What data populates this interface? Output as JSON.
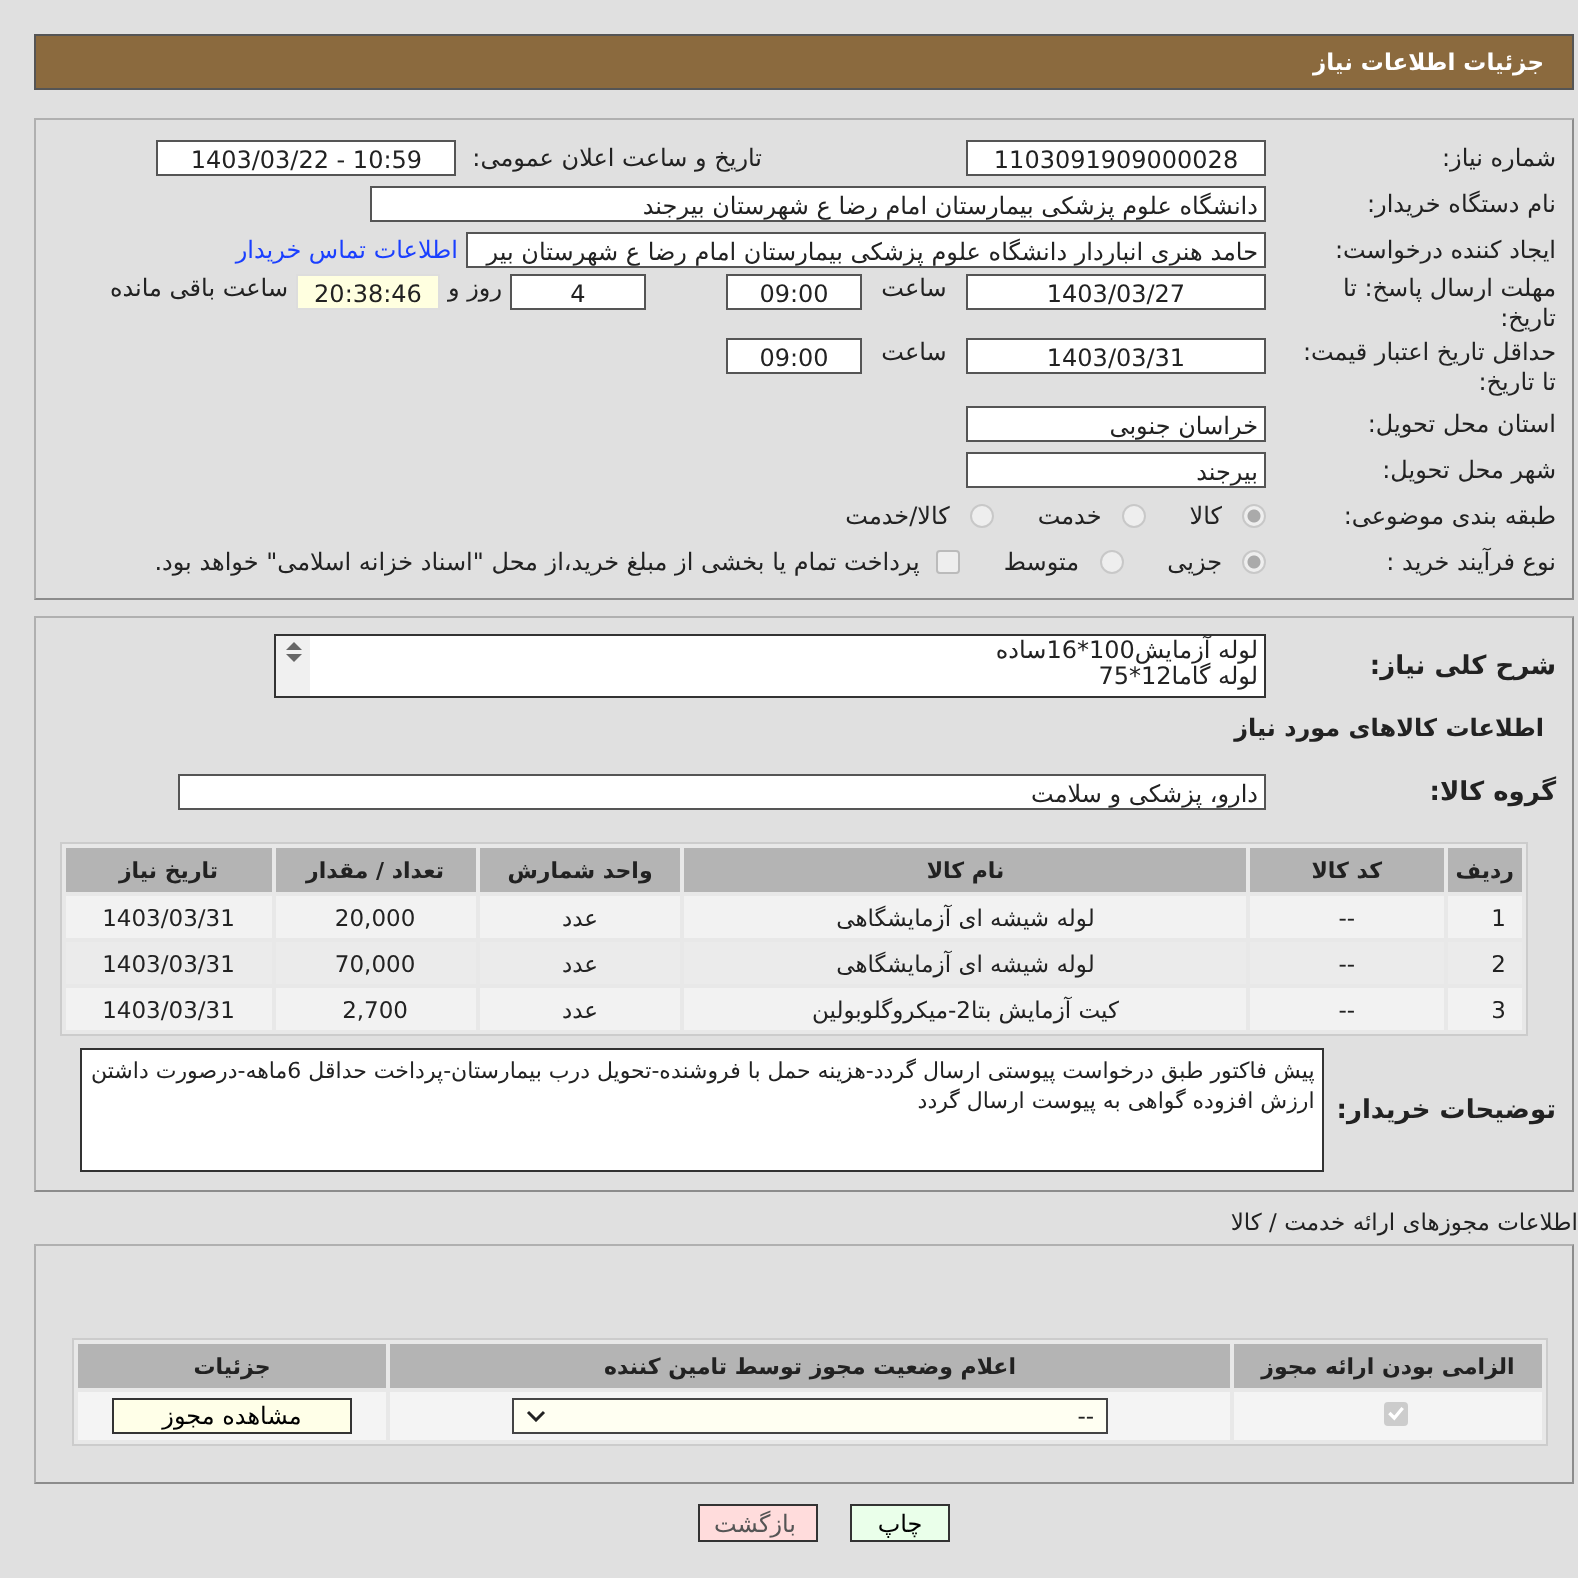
{
  "header": {
    "title": "جزئیات اطلاعات نیاز"
  },
  "need_info": {
    "need_number": {
      "label": "شماره نیاز:",
      "value": "1103091909000028"
    },
    "announce": {
      "label": "تاریخ و ساعت اعلان عمومی:",
      "value": "1403/03/22 - 10:59"
    },
    "buyer_org": {
      "label": "نام دستگاه خریدار:",
      "value": "دانشگاه علوم پزشکی  بیمارستان امام رضا ع  شهرستان بیرجند"
    },
    "creator": {
      "label": "ایجاد کننده درخواست:",
      "value": "حامد هنری انباردار دانشگاه علوم پزشکی  بیمارستان امام رضا ع  شهرستان بیر",
      "link": "اطلاعات تماس خریدار"
    },
    "deadline": {
      "label": "مهلت ارسال پاسخ: تا تاریخ:",
      "date": "1403/03/27",
      "time_label": "ساعت",
      "time": "09:00",
      "days": "4",
      "days_label": "روز و",
      "remaining": "20:38:46",
      "remaining_label": "ساعت باقی مانده"
    },
    "validity": {
      "label": "حداقل تاریخ اعتبار قیمت: تا تاریخ:",
      "date": "1403/03/31",
      "time_label": "ساعت",
      "time": "09:00"
    },
    "province": {
      "label": "استان محل تحویل:",
      "value": "خراسان جنوبی"
    },
    "city": {
      "label": "شهر محل تحویل:",
      "value": "بیرجند"
    },
    "category": {
      "label": "طبقه بندی موضوعی:",
      "options": [
        {
          "label": "کالا",
          "selected": true
        },
        {
          "label": "خدمت",
          "selected": false
        },
        {
          "label": "کالا/خدمت",
          "selected": false
        }
      ]
    },
    "process": {
      "label": "نوع فرآیند خرید :",
      "options": [
        {
          "label": "جزیی",
          "selected": true
        },
        {
          "label": "متوسط",
          "selected": false
        }
      ],
      "treasury": {
        "label": "پرداخت تمام یا بخشی از مبلغ خرید،از محل \"اسناد خزانه اسلامی\" خواهد بود.",
        "checked": false
      }
    }
  },
  "goods": {
    "description_label": "شرح کلی نیاز:",
    "description": "لوله آزمایش100*16ساده\nلوله گاما12*75",
    "heading": "اطلاعات کالاهای مورد نیاز",
    "group": {
      "label": "گروه کالا:",
      "value": "دارو، پزشکی و سلامت"
    },
    "columns": [
      "ردیف",
      "کد کالا",
      "نام کالا",
      "واحد شمارش",
      "تعداد / مقدار",
      "تاریخ نیاز"
    ],
    "rows": [
      [
        "1",
        "--",
        "لوله شیشه ای آزمایشگاهی",
        "عدد",
        "20,000",
        "1403/03/31"
      ],
      [
        "2",
        "--",
        "لوله شیشه ای آزمایشگاهی",
        "عدد",
        "70,000",
        "1403/03/31"
      ],
      [
        "3",
        "--",
        "کیت آزمایش بتا2-میکروگلوبولین",
        "عدد",
        "2,700",
        "1403/03/31"
      ]
    ],
    "notes_label": "توضیحات خریدار:",
    "notes": "پیش فاکتور طبق درخواست پیوستی ارسال گردد-هزینه حمل با فروشنده-تحویل درب بیمارستان-پرداخت حداقل 6ماهه-درصورت داشتن ارزش افزوده گواهی به پیوست ارسال گردد"
  },
  "permits": {
    "title": "اطلاعات مجوزهای ارائه خدمت / کالا",
    "columns": [
      "الزامی بودن ارائه مجوز",
      "اعلام وضعیت مجوز توسط تامین کننده",
      "جزئیات"
    ],
    "rows": [
      {
        "required": true,
        "status": "--",
        "details": "مشاهده مجوز"
      }
    ]
  },
  "buttons": [
    {
      "label": "چاپ",
      "kind": "print"
    },
    {
      "label": "بازگشت",
      "kind": "back"
    }
  ]
}
